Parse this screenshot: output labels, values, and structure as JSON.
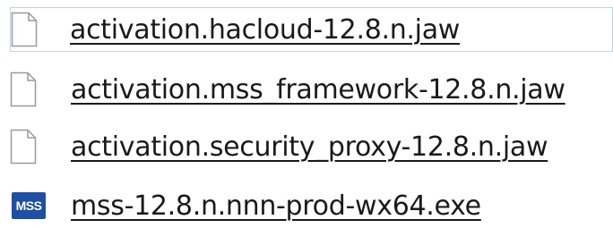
{
  "files": [
    {
      "name": "activation.hacloud-12.8.n.jaw",
      "icon": "document-icon"
    },
    {
      "name": "activation.mss_framework-12.8.n.jaw",
      "icon": "document-icon"
    },
    {
      "name": "activation.security_proxy-12.8.n.jaw",
      "icon": "document-icon"
    },
    {
      "name": "mss-12.8.n.nnn-prod-wx64.exe",
      "icon": "mss-icon",
      "icon_text": "MSS"
    }
  ],
  "colors": {
    "hover_border": "#b9d4ef",
    "mss_icon_bg": "#1d4fa3",
    "link_text": "#1a1a1a"
  }
}
